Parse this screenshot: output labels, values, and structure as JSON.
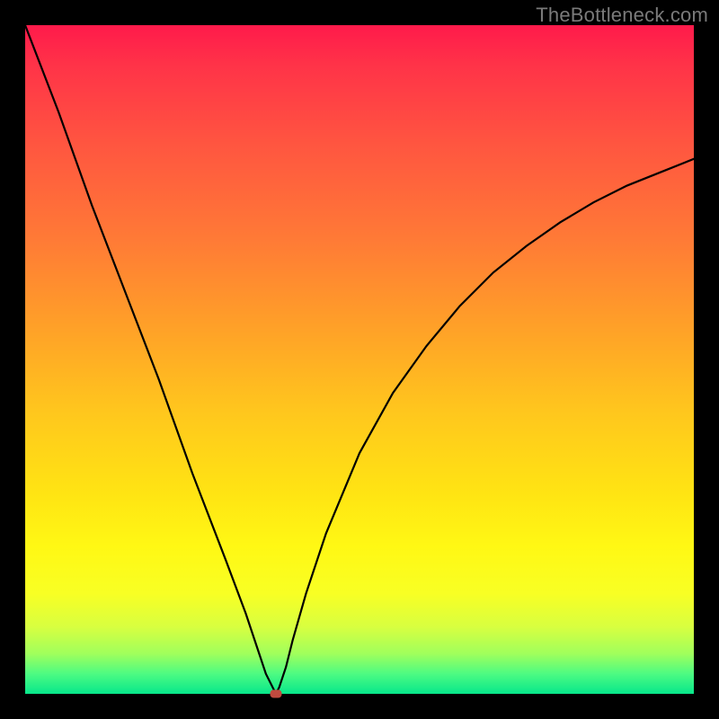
{
  "watermark": "TheBottleneck.com",
  "chart_data": {
    "type": "line",
    "title": "",
    "xlabel": "",
    "ylabel": "",
    "xlim": [
      0,
      100
    ],
    "ylim": [
      0,
      100
    ],
    "grid": false,
    "series": [
      {
        "name": "curve",
        "x": [
          0,
          5,
          10,
          15,
          20,
          25,
          30,
          33,
          35,
          36,
          37,
          37.5,
          38,
          39,
          40,
          42,
          45,
          50,
          55,
          60,
          65,
          70,
          75,
          80,
          85,
          90,
          95,
          100
        ],
        "values": [
          100,
          87,
          73,
          60,
          47,
          33,
          20,
          12,
          6,
          3,
          1,
          0,
          1,
          4,
          8,
          15,
          24,
          36,
          45,
          52,
          58,
          63,
          67,
          70.5,
          73.5,
          76,
          78,
          80
        ]
      }
    ],
    "marker": {
      "x": 37.5,
      "y": 0
    },
    "gradient": {
      "top": "#ff1a4b",
      "bottom": "#07e78b"
    }
  }
}
